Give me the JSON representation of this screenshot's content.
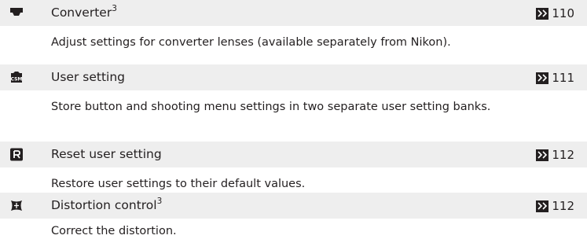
{
  "entries": [
    {
      "icon": "converter-lens-icon",
      "title": "Converter",
      "title_sup": "3",
      "page_ref_icon": "page-reference-icon",
      "page": "110",
      "description": "Adjust settings for converter lenses (available separately from Nikon)."
    },
    {
      "icon": "csm-user-setting-icon",
      "title": "User setting",
      "title_sup": "",
      "page_ref_icon": "page-reference-icon",
      "page": "111",
      "description": "Store button and shooting menu settings in two separate user setting banks."
    },
    {
      "icon": "reset-r-icon",
      "title": "Reset user setting",
      "title_sup": "",
      "page_ref_icon": "page-reference-icon",
      "page": "112",
      "description": "Restore user settings to their default values."
    },
    {
      "icon": "distortion-control-icon",
      "title": "Distortion control",
      "title_sup": "3",
      "page_ref_icon": "page-reference-icon",
      "page": "112",
      "description": "Correct the distortion."
    }
  ]
}
